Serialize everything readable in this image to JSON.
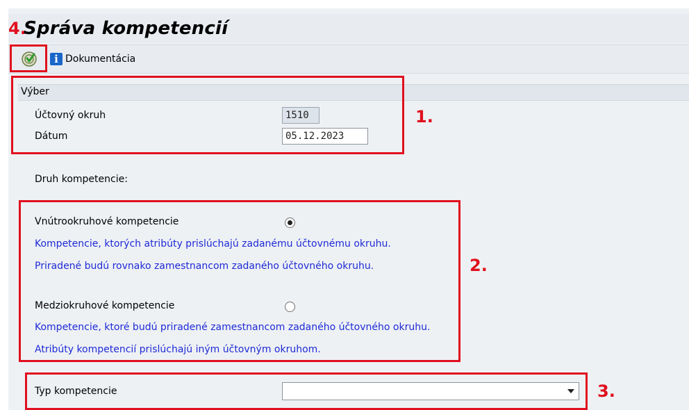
{
  "header": {
    "step_marker": "4.",
    "title": "Správa kompetencií"
  },
  "toolbar": {
    "execute_icon": "execute-icon",
    "doc_icon": "info-icon",
    "doc_icon_glyph": "i",
    "documentation_label": "Dokumentácia"
  },
  "selection": {
    "title": "Výber",
    "company_code_label": "Účtovný okruh",
    "company_code_value": "1510",
    "date_label": "Dátum",
    "date_value": "05.12.2023"
  },
  "competence_type_prompt": "Druh kompetencie:",
  "options": [
    {
      "label": "Vnútrookruhové kompetencie",
      "selected": true,
      "desc1": "Kompetencie, ktorých atribúty prislúchajú zadanému účtovnému okruhu.",
      "desc2": "Priradené budú rovnako zamestnancom zadaného účtovného okruhu."
    },
    {
      "label": "Medziokruhové kompetencie",
      "selected": false,
      "desc1": "Kompetencie, ktoré budú priradené zamestnancom zadaného účtovného okruhu.",
      "desc2": "Atribúty kompetencií prislúchajú iným účtovným okruhom."
    }
  ],
  "type_field": {
    "label": "Typ kompetencie",
    "value": ""
  },
  "annotations": {
    "one": "1.",
    "two": "2.",
    "three": "3."
  },
  "colors": {
    "annotation": "#e0101e",
    "description_text": "#1d2ad6",
    "header_bg": "#e8ecf1"
  }
}
